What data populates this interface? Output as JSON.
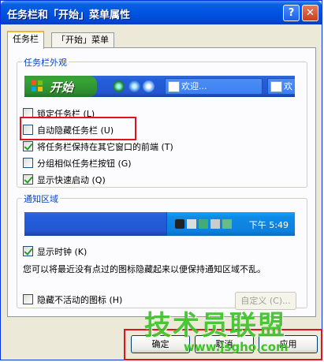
{
  "window": {
    "title": "任务栏和「开始」菜单属性",
    "help": "?",
    "close": "✕"
  },
  "tabs": [
    "任务栏",
    "「开始」菜单"
  ],
  "appearance": {
    "legend": "任务栏外观",
    "start_label": "开始",
    "task_buttons": [
      "欢迎...",
      "欢"
    ],
    "options": [
      {
        "label": "锁定任务栏 (L)",
        "checked": false
      },
      {
        "label": "自动隐藏任务栏 (U)",
        "checked": false
      },
      {
        "label": "将任务栏保持在其它窗口的前端 (T)",
        "checked": true
      },
      {
        "label": "分组相似任务栏按钮 (G)",
        "checked": false
      },
      {
        "label": "显示快速启动 (Q)",
        "checked": true
      }
    ]
  },
  "notification": {
    "legend": "通知区域",
    "clock_text": "下午 5:49",
    "show_clock": {
      "label": "显示时钟 (K)",
      "checked": true
    },
    "description": "您可以将最近没有点过的图标隐藏起来以便保持通知区域不乱。",
    "hide_inactive": {
      "label": "隐藏不活动的图标 (H)",
      "checked": false
    },
    "customize_label": "自定义 (C)..."
  },
  "buttons": {
    "ok": "确定",
    "cancel": "取消",
    "apply": "应用"
  },
  "watermark": {
    "main": "技术员联盟",
    "url": "www.jsgho.com"
  },
  "colors": {
    "highlight": "#e0141e",
    "accent": "#0046d5"
  }
}
